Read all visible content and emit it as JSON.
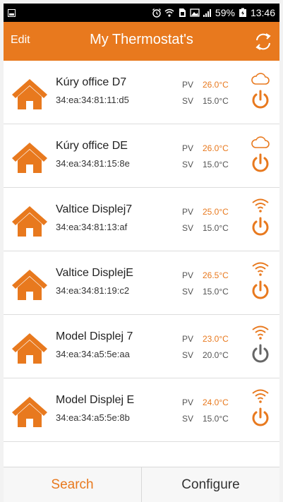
{
  "status_bar": {
    "battery": "59%",
    "time": "13:46",
    "icons": [
      "notification-square-icon",
      "alarm-icon",
      "wifi-icon",
      "sim-icon",
      "image-icon",
      "signal-icon",
      "battery-icon"
    ]
  },
  "header": {
    "edit_label": "Edit",
    "title": "My Thermostat's",
    "refresh_icon": "refresh-icon"
  },
  "colors": {
    "accent": "#e8791e",
    "power_off": "#666666",
    "divider": "#dddddd"
  },
  "thermostats": [
    {
      "name": "Kúry office D7",
      "mac": "34:ea:34:81:11:d5",
      "pv_label": "PV",
      "pv": "26.0°C",
      "sv_label": "SV",
      "sv": "15.0°C",
      "connection": "cloud",
      "power": "on"
    },
    {
      "name": "Kúry office DE",
      "mac": "34:ea:34:81:15:8e",
      "pv_label": "PV",
      "pv": "26.0°C",
      "sv_label": "SV",
      "sv": "15.0°C",
      "connection": "cloud",
      "power": "on"
    },
    {
      "name": "Valtice Displej7",
      "mac": "34:ea:34:81:13:af",
      "pv_label": "PV",
      "pv": "25.0°C",
      "sv_label": "SV",
      "sv": "15.0°C",
      "connection": "wifi",
      "power": "on"
    },
    {
      "name": "Valtice DisplejE",
      "mac": "34:ea:34:81:19:c2",
      "pv_label": "PV",
      "pv": "26.5°C",
      "sv_label": "SV",
      "sv": "15.0°C",
      "connection": "wifi",
      "power": "on"
    },
    {
      "name": "Model Displej 7",
      "mac": "34:ea:34:a5:5e:aa",
      "pv_label": "PV",
      "pv": "23.0°C",
      "sv_label": "SV",
      "sv": "20.0°C",
      "connection": "wifi",
      "power": "off"
    },
    {
      "name": "Model Displej E",
      "mac": "34:ea:34:a5:5e:8b",
      "pv_label": "PV",
      "pv": "24.0°C",
      "sv_label": "SV",
      "sv": "15.0°C",
      "connection": "wifi",
      "power": "on"
    }
  ],
  "bottom": {
    "search_label": "Search",
    "configure_label": "Configure"
  }
}
